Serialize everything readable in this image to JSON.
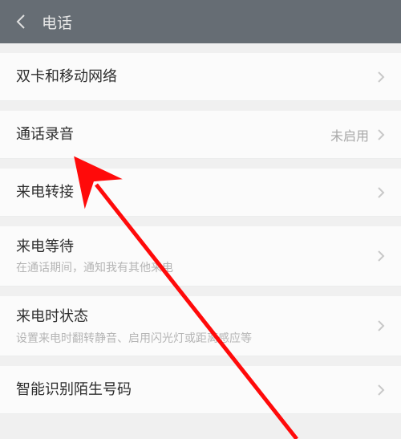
{
  "header": {
    "title": "电话"
  },
  "rows": {
    "sim_network": {
      "title": "双卡和移动网络"
    },
    "call_recording": {
      "title": "通话录音",
      "value": "未启用"
    },
    "call_forwarding": {
      "title": "来电转接"
    },
    "call_waiting": {
      "title": "来电等待",
      "sub": "在通话期间，通知我有其他来电"
    },
    "incoming_state": {
      "title": "来电时状态",
      "sub": "设置来电时翻转静音、启用闪光灯或距离感应等"
    },
    "smart_id": {
      "title": "智能识别陌生号码"
    }
  },
  "annotation": {
    "color": "#ff0a0a"
  }
}
